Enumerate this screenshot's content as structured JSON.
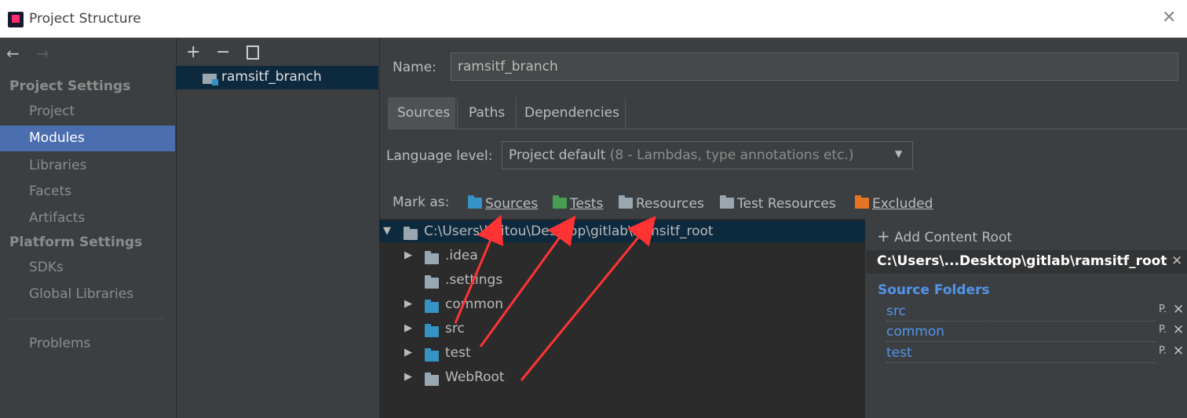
{
  "window": {
    "title": "Project Structure",
    "close_glyph": "✕"
  },
  "nav_arrows": {
    "back": "←",
    "forward": "→"
  },
  "left_nav": {
    "project_settings_header": "Project Settings",
    "items_project": [
      "Project",
      "Modules",
      "Libraries",
      "Facets",
      "Artifacts"
    ],
    "platform_settings_header": "Platform Settings",
    "items_platform": [
      "SDKs",
      "Global Libraries"
    ],
    "problems": "Problems",
    "selected": "Modules"
  },
  "module_toolbar": {
    "add": "+",
    "remove": "−",
    "copy_icon": "copy-icon"
  },
  "modules": [
    {
      "name": "ramsitf_branch"
    }
  ],
  "name_field": {
    "label": "Name:",
    "value": "ramsitf_branch"
  },
  "tabs": [
    "Sources",
    "Paths",
    "Dependencies"
  ],
  "selected_tab": "Sources",
  "language_level": {
    "label": "Language level:",
    "value": "Project default",
    "value_detail": "(8 - Lambdas, type annotations etc.)"
  },
  "mark_as": {
    "label": "Mark as:",
    "items": [
      {
        "label": "Sources",
        "color": "#3592c4"
      },
      {
        "label": "Tests",
        "color": "#499c54"
      },
      {
        "label": "Resources",
        "color": "#9aa7b0"
      },
      {
        "label": "Test Resources",
        "color": "#9aa7b0"
      },
      {
        "label": "Excluded",
        "color": "#e57423"
      }
    ]
  },
  "tree": {
    "root": "C:\\Users\\haitou\\Desktop\\gitlab\\ramsitf_root",
    "children": [
      {
        "name": ".idea",
        "expandable": true,
        "color": "#9aa7b0"
      },
      {
        "name": ".settings",
        "expandable": false,
        "color": "#9aa7b0"
      },
      {
        "name": "common",
        "expandable": true,
        "color": "#3592c4"
      },
      {
        "name": "src",
        "expandable": true,
        "color": "#3592c4"
      },
      {
        "name": "test",
        "expandable": true,
        "color": "#3592c4"
      },
      {
        "name": "WebRoot",
        "expandable": true,
        "color": "#9aa7b0"
      }
    ]
  },
  "content_root_pane": {
    "add_label": "Add Content Root",
    "root_path": "C:\\Users\\...Desktop\\gitlab\\ramsitf_root",
    "source_folders_header": "Source Folders",
    "source_folders": [
      "src",
      "common",
      "test"
    ],
    "row_action": "P."
  },
  "colors": {
    "accent": "#4b6eaf",
    "selection": "#0d293e",
    "annotation_arrow": "#ff3333"
  }
}
